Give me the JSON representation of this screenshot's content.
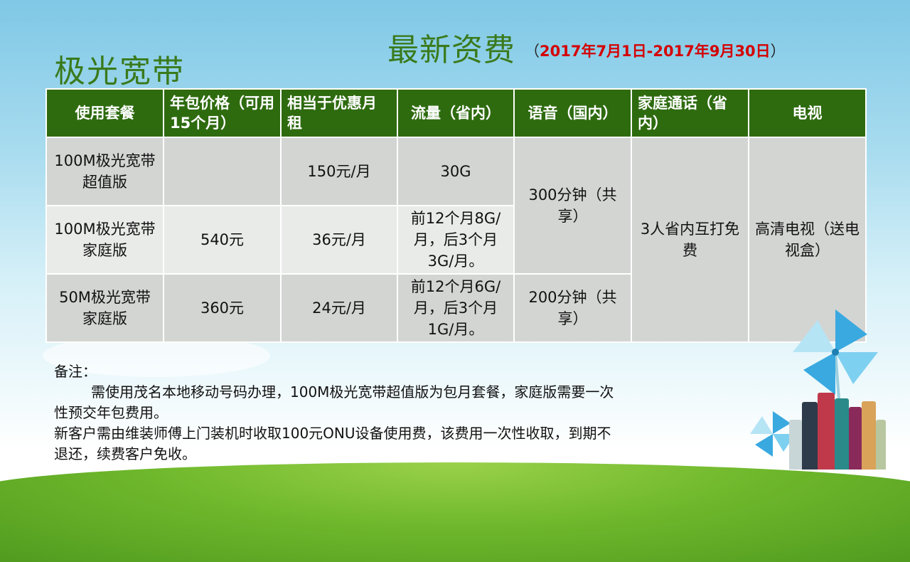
{
  "left_title": "极光宽带",
  "main_title": "最新资费",
  "date_open": "（",
  "date_range": "2017年7月1日-2017年9月30日",
  "date_close": "）",
  "table": {
    "headers": [
      "使用套餐",
      "年包价格（可用15个月）",
      "相当于优惠月租",
      "流量（省内）",
      "语音（国内）",
      "家庭通话（省内）",
      "电视"
    ],
    "rows": [
      {
        "plan_line1": "100M极光宽带",
        "plan_line2": "超值版",
        "price": "",
        "monthly": "150元/月",
        "data": "30G"
      },
      {
        "plan_line1": "100M极光宽带",
        "plan_line2": "家庭版",
        "price": "540元",
        "monthly": "36元/月",
        "data": "前12个月8G/月，后3个月3G/月。"
      },
      {
        "plan_line1": "50M极光宽带",
        "plan_line2": "家庭版",
        "price": "360元",
        "monthly": "24元/月",
        "data": "前12个月6G/月，后3个月1G/月。"
      }
    ],
    "voice_shared_1": "300分钟（共享）",
    "voice_2": "200分钟（共享）",
    "family_call": "3人省内互打免费",
    "tv": "高清电视（送电视盒）"
  },
  "notes": {
    "heading": "备注：",
    "line1": "需使用茂名本地移动号码办理，100M极光宽带超值版为包月套餐，家庭版需要一次性预交年包费用。",
    "line2": "新客户需由维装师傅上门装机时收取100元ONU设备使用费，该费用一次性收取，到期不退还，续费客户免收。"
  },
  "colors": {
    "header_green": "#2e6b0f",
    "title_green": "#3a7a1c",
    "date_red": "#d40000",
    "price_purple": "#7a3fa8"
  }
}
